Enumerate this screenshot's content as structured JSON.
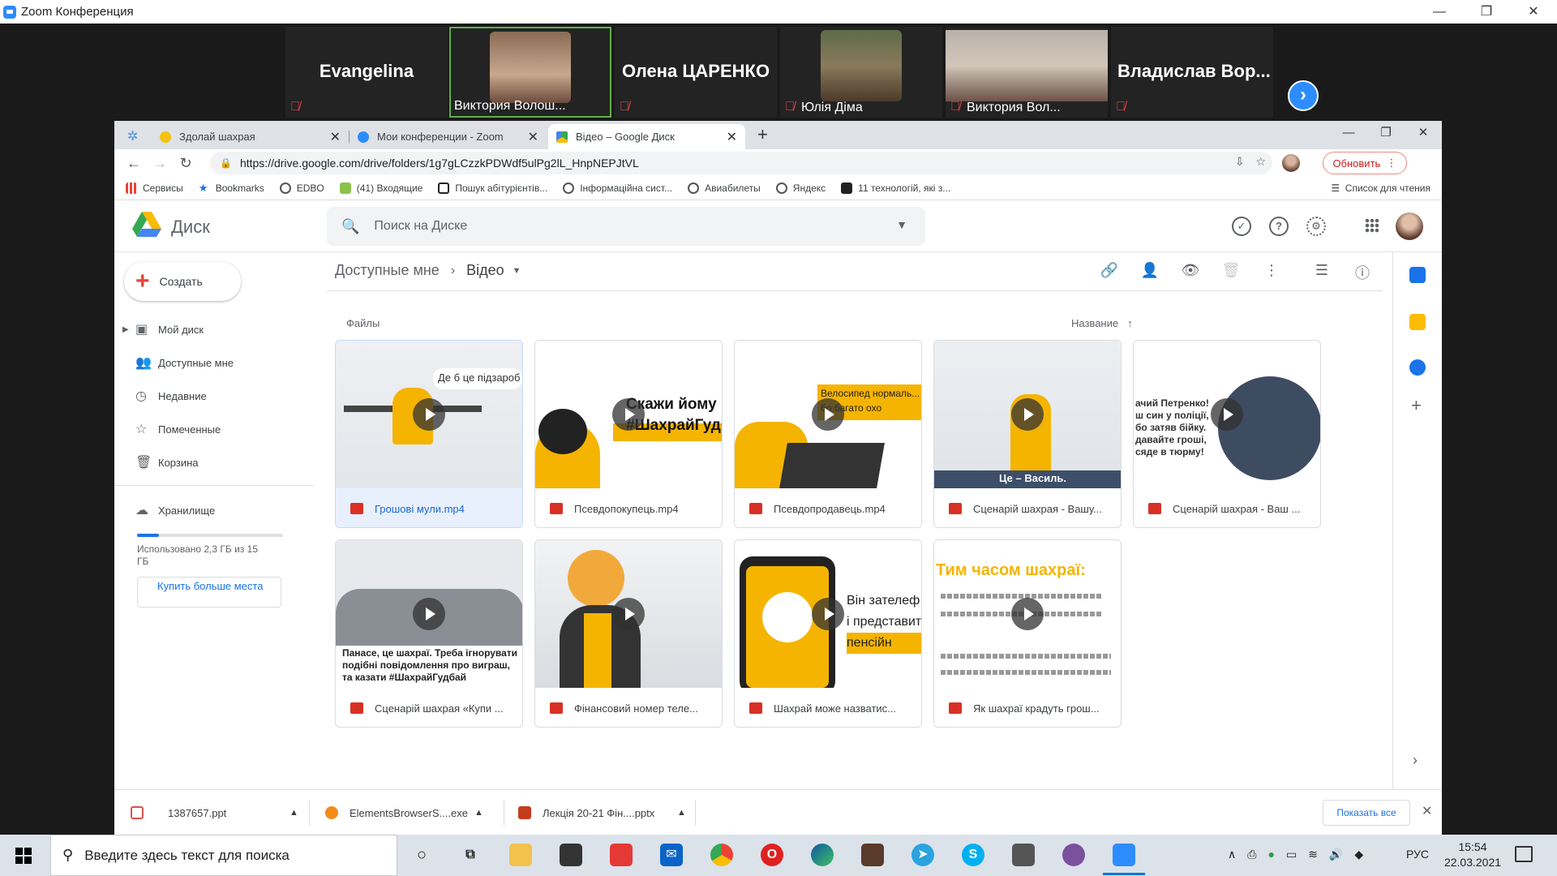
{
  "zoom": {
    "window_title": "Zoom Конференция",
    "participants": [
      {
        "name": "Evangelina",
        "video": false
      },
      {
        "name": "Виктория Волош...",
        "video": true
      },
      {
        "name": "Олена ЦАРЕНКО",
        "video": false
      },
      {
        "name": "Юлія Діма",
        "video": true
      },
      {
        "name": "Виктория Вол...",
        "video": true
      },
      {
        "name": "Владислав  Вор...",
        "video": false
      }
    ]
  },
  "browser": {
    "tabs": [
      {
        "label": "Здолай шахрая",
        "active": false
      },
      {
        "label": "Мои конференции - Zoom",
        "active": false
      },
      {
        "label": "Відео – Google Диск",
        "active": true
      }
    ],
    "url": "https://drive.google.com/drive/folders/1g7gLCzzkPDWdf5ulPg2lL_HnpNEPJtVL",
    "update_label": "Обновить",
    "bookmarks": [
      "Сервисы",
      "Bookmarks",
      "EDBO",
      "(41) Входящие",
      "Пошук абітурієнтів...",
      "Інформаційна сист...",
      "Авиабилеты",
      "Яндекс",
      "11 технологій, які з..."
    ],
    "reading_list": "Список для чтения"
  },
  "drive": {
    "title": "Диск",
    "search_placeholder": "Поиск на Диске",
    "create_label": "Создать",
    "nav": [
      "Мой диск",
      "Доступные мне",
      "Недавние",
      "Помеченные",
      "Корзина"
    ],
    "storage_label": "Хранилище",
    "storage_used": "Использовано 2,3 ГБ из 15 ГБ",
    "storage_fraction": 0.15,
    "buy_label": "Купить больше места",
    "breadcrumb_root": "Доступные мне",
    "breadcrumb_current": "Відео",
    "files_label": "Файлы",
    "sort_label": "Название",
    "files": [
      {
        "name": "Грошові мули.mp4",
        "thumb_text": "Де б це підзароб",
        "selected": true
      },
      {
        "name": "Псевдопокупець.mp4",
        "thumb_text": "Скажи йому #ШахрайГудб",
        "selected": false
      },
      {
        "name": "Псевдопродавець.mp4",
        "thumb_text": "Велосипед нормаль... бо багато охо",
        "selected": false
      },
      {
        "name": "Сценарій шахрая - Вашу...",
        "thumb_text": "Це – Василь.",
        "selected": false
      },
      {
        "name": "Сценарій шахрая - Ваш ...",
        "thumb_text": "ачий Петренко! ш син у поліції, бо затяв бійку. давайте гроші, сяде в тюрму!",
        "selected": false
      },
      {
        "name": "Сценарій шахрая «Купи ...",
        "thumb_text": "Панасе, це шахраї. Треба ігнорувати подібні повідомлення про виграш, та казати #ШахрайГудбай",
        "selected": false
      },
      {
        "name": "Фінансовий номер теле...",
        "thumb_text": "",
        "selected": false
      },
      {
        "name": "Шахрай може назватис...",
        "thumb_text": "Він зателеф і представит пенсійн",
        "selected": false
      },
      {
        "name": "Як шахраї крадуть грош...",
        "thumb_text": "Тим часом шахраї:",
        "selected": false
      }
    ]
  },
  "downloads": {
    "items": [
      "1387657.ppt",
      "ElementsBrowserS....exe",
      "Лекція 20-21 Фін....pptx"
    ],
    "show_all": "Показать все"
  },
  "taskbar": {
    "search_placeholder": "Введите здесь текст для поиска",
    "lang": "РУС",
    "time": "15:54",
    "date": "22.03.2021"
  }
}
